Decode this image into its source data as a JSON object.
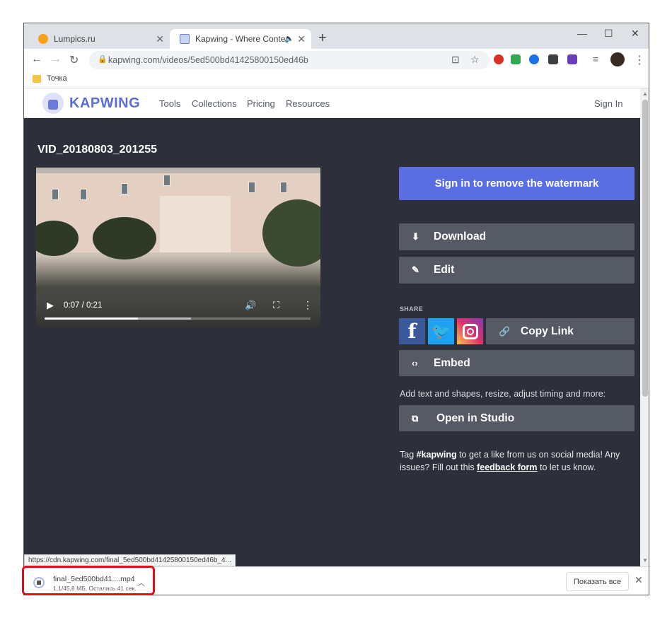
{
  "browser": {
    "tabs": [
      {
        "title": "Lumpics.ru",
        "favicon_color": "#f7a21a"
      },
      {
        "title": "Kapwing - Where Content Cr",
        "active": true
      }
    ],
    "url": "kapwing.com/videos/5ed500bd41425800150ed46b",
    "bookmark": "Точка",
    "status_url": "https://cdn.kapwing.com/final_5ed500bd41425800150ed46b_4..."
  },
  "site": {
    "logo": "KAPWING",
    "nav": [
      "Tools",
      "Collections",
      "Pricing",
      "Resources"
    ],
    "signin": "Sign In",
    "brand_color": "#5b6ee1"
  },
  "video": {
    "title": "VID_20180803_201255",
    "time": "0:07 / 0:21",
    "played_fraction": 0.35,
    "buffered_fraction": 0.55
  },
  "actions": {
    "watermark": "Sign in to remove the watermark",
    "download": "Download",
    "edit": "Edit",
    "share_label": "SHARE",
    "copy_link": "Copy Link",
    "embed": "Embed",
    "studio_prompt": "Add text and shapes, resize, adjust timing and more:",
    "open_studio": "Open in Studio"
  },
  "tag_text": {
    "prefix": "Tag ",
    "hashtag": "#kapwing",
    "middle": " to get a like from us on social media! Any issues? Fill out this ",
    "link": "feedback form",
    "suffix": " to let us know."
  },
  "download_shelf": {
    "file_name": "final_5ed500bd41....mp4",
    "status": "1,1/45,8 МБ, Осталась 41 сек.",
    "show_all": "Показать все"
  }
}
